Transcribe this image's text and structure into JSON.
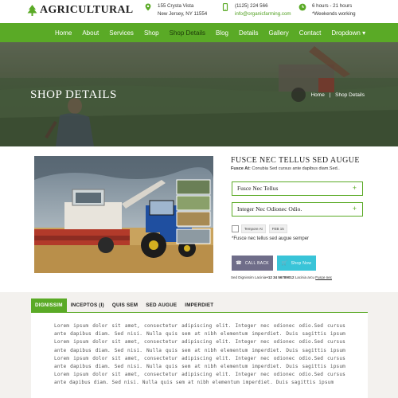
{
  "header": {
    "brand": "AGRICULTURAL",
    "address_line1": "155 Crysta Vista",
    "address_line2": "New Jersey, NY 11554",
    "phone": "(1125) 224 566",
    "email": "info@organicfarming.com",
    "hours_line1": "6 hours - 21 hours",
    "hours_line2": "*Weekends working"
  },
  "nav": {
    "items": [
      {
        "label": "Home"
      },
      {
        "label": "About"
      },
      {
        "label": "Services"
      },
      {
        "label": "Shop"
      },
      {
        "label": "Shop Details"
      },
      {
        "label": "Blog"
      },
      {
        "label": "Details"
      },
      {
        "label": "Gallery"
      },
      {
        "label": "Contact"
      },
      {
        "label": "Dropdown ▾"
      }
    ],
    "active_index": 4
  },
  "banner": {
    "title": "SHOP DETAILS",
    "breadcrumb": [
      "Home",
      "Shop Details"
    ],
    "separator": "|"
  },
  "product": {
    "title": "FUSCE NEC TELLUS SED AUGUE",
    "subtitle_bold": "Fusce At:",
    "subtitle_rest": " Conubia Sed cursus ante dapibus diam.Sed..",
    "accordion": [
      {
        "label": "Fusce Nec Tellus",
        "icon": "plus-icon",
        "symbol": "+"
      },
      {
        "label": "Integer Nec Odionec Odio.",
        "icon": "plus-icon",
        "symbol": "+"
      }
    ],
    "chips": [
      "Tempore At",
      "FEB 15"
    ],
    "note": "*Fusce nec tellus sed augue semper",
    "call_back_label": "CALL BACK",
    "shop_now_label": "Shop Now",
    "contact_prefix": "Sed Dignissim Lacinia",
    "contact_phone": "+12 34 56789012",
    "contact_middle": " Lacinia arcu ",
    "contact_link": "Fusce nec"
  },
  "tabs": {
    "items": [
      "DIGNISSIM",
      "INCEPTOS (I)",
      "QUIS SEM",
      "SED AUGUE",
      "IMPERDIET"
    ],
    "active_index": 0,
    "content": "Lorem ipsum dolor sit amet, consectetur adipiscing elit. Integer nec odionec odio.Sed cursus ante dapibus diam. Sed nisi. Nulla quis sem at nibh elementum imperdiet. Duis sagittis ipsum Lorem ipsum dolor sit amet, consectetur adipiscing elit. Integer nec odionec odio.Sed cursus ante dapibus diam. Sed nisi. Nulla quis sem at nibh elementum imperdiet. Duis sagittis ipsum Lorem ipsum dolor sit amet, consectetur adipiscing elit. Integer nec odionec odio.Sed cursus ante dapibus diam. Sed nisi. Nulla quis sem at nibh elementum imperdiet. Duis sagittis ipsum Lorem ipsum dolor sit amet, consectetur adipiscing elit. Integer nec odionec odio.Sed cursus ante dapibus diam. Sed nisi. Nulla quis sem at nibh elementum imperdiet. Duis sagittis ipsum"
  },
  "colors": {
    "accent_green": "#5aaa26",
    "call_button": "#6f6d89",
    "shop_button": "#39c4d8"
  }
}
